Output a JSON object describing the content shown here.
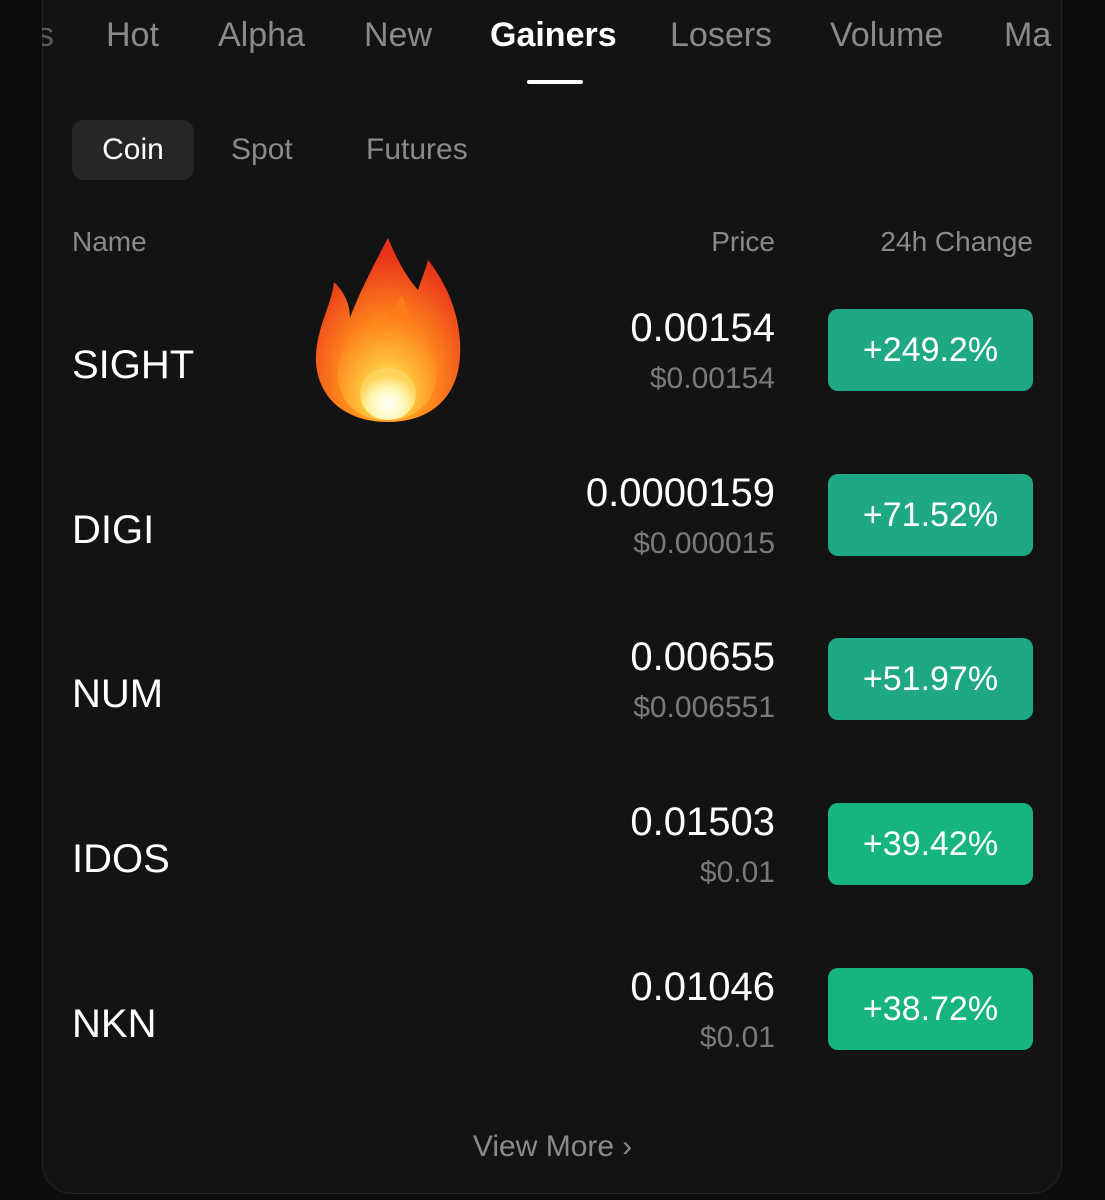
{
  "market_tabs": [
    {
      "label": "Hot"
    },
    {
      "label": "Alpha"
    },
    {
      "label": "New"
    },
    {
      "label": "Gainers",
      "active": true
    },
    {
      "label": "Losers"
    },
    {
      "label": "Volume"
    },
    {
      "label": "Ma"
    }
  ],
  "clipped_left_tab": "s",
  "sub_tabs": [
    {
      "label": "Coin",
      "active": true
    },
    {
      "label": "Spot"
    },
    {
      "label": "Futures"
    }
  ],
  "table": {
    "headers": {
      "name": "Name",
      "price": "Price",
      "change": "24h Change"
    },
    "rows": [
      {
        "symbol": "SIGHT",
        "price": "0.00154",
        "usd_price": "$0.00154",
        "change": "+249.2%"
      },
      {
        "symbol": "DIGI",
        "price": "0.0000159",
        "usd_price": "$0.000015",
        "change": "+71.52%"
      },
      {
        "symbol": "NUM",
        "price": "0.00655",
        "usd_price": "$0.006551",
        "change": "+51.97%"
      },
      {
        "symbol": "IDOS",
        "price": "0.01503",
        "usd_price": "$0.01",
        "change": "+39.42%"
      },
      {
        "symbol": "NKN",
        "price": "0.01046",
        "usd_price": "$0.01",
        "change": "+38.72%"
      }
    ]
  },
  "view_more": {
    "label": "View More",
    "icon": "chevron-right-icon"
  },
  "decoration": {
    "icon": "fire-emoji-icon"
  },
  "colors": {
    "background": "#131313",
    "positive": "#1fa884",
    "positive_bright": "#16b47f",
    "muted_text": "#8a8a8a"
  }
}
